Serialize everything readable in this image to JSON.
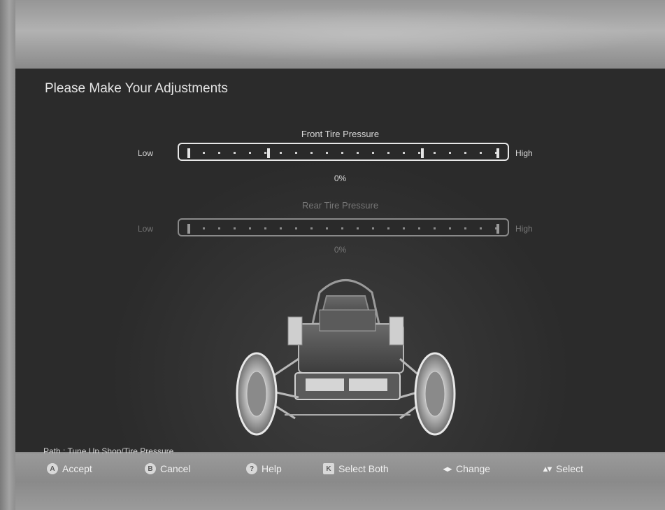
{
  "screen": {
    "title": "Please Make Your Adjustments",
    "path": "Path : Tune Up Shop/Tire Pressure"
  },
  "sliders": [
    {
      "label": "Front Tire Pressure",
      "low": "Low",
      "high": "High",
      "value_text": "0%",
      "value": 0,
      "active": true
    },
    {
      "label": "Rear Tire Pressure",
      "low": "Low",
      "high": "High",
      "value_text": "0%",
      "value": 0,
      "active": false
    }
  ],
  "controls": [
    {
      "icon": "A",
      "label": "Accept"
    },
    {
      "icon": "B",
      "label": "Cancel"
    },
    {
      "icon": "?",
      "label": "Help"
    },
    {
      "icon": "K",
      "label": "Select Both"
    },
    {
      "icon": "◂▸",
      "label": "Change"
    },
    {
      "icon": "▴▾",
      "label": "Select"
    }
  ]
}
